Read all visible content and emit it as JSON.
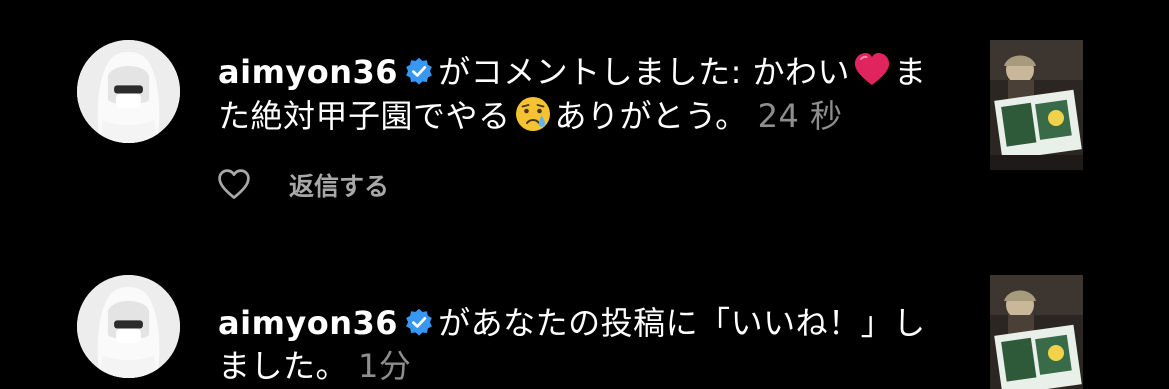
{
  "notifications": [
    {
      "username": "aimyon36",
      "text_before_heart": "がコメントしました: かわい",
      "heart_emoji": "red-heart",
      "text_after_heart": "また絶対甲子園でやる",
      "cry_emoji": "crying-face",
      "text_end": "ありがとう。",
      "time": "24 秒",
      "reply_label": "返信する",
      "verified_icon": "verified-badge-icon",
      "thumbnail": "post-thumbnail"
    },
    {
      "username": "aimyon36",
      "text": "があなたの投稿に「いいね！」しました。",
      "time": "1分",
      "verified_icon": "verified-badge-icon",
      "thumbnail": "post-thumbnail"
    }
  ],
  "colors": {
    "background": "#000000",
    "text": "#ffffff",
    "muted": "#8e8e8e",
    "verified": "#3897f0",
    "heart": "#e0245e"
  }
}
